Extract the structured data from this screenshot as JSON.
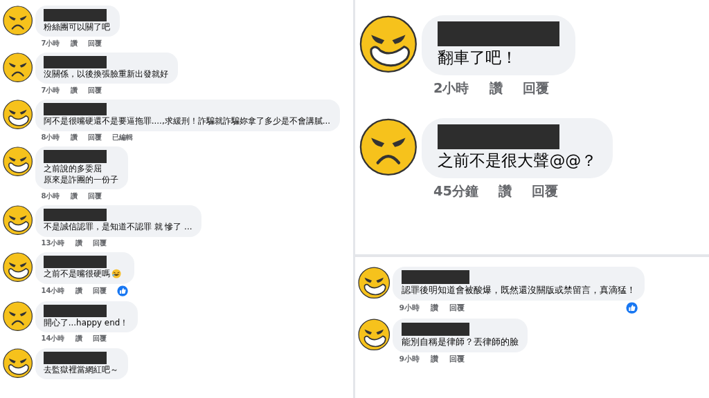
{
  "panels": [
    {
      "comments": [
        {
          "kind": "angry",
          "lines": [
            "粉絲團可以關了吧"
          ],
          "time": "7小時",
          "actions": [
            "讚",
            "回覆"
          ],
          "liked": false
        },
        {
          "kind": "angry",
          "lines": [
            "沒關係，以後換張臉重新出發就好"
          ],
          "time": "7小時",
          "actions": [
            "讚",
            "回覆"
          ],
          "liked": false
        },
        {
          "kind": "grin",
          "lines": [
            "阿不是很嘴硬還不是要逼拖罪....,求緩刑！詐騙就詐騙妳拿了多少是不會講膩..."
          ],
          "time": "8小時",
          "actions": [
            "讚",
            "回覆",
            "已編輯"
          ],
          "liked": false
        },
        {
          "kind": "grin",
          "lines": [
            "之前說的多委屈",
            "原來是詐團的一份子"
          ],
          "time": "8小時",
          "actions": [
            "讚",
            "回覆"
          ],
          "liked": false
        },
        {
          "kind": "grin",
          "lines": [
            "不是誠信認罪，是知道不認罪 就 慘了 ..."
          ],
          "time": "13小時",
          "actions": [
            "讚",
            "回覆"
          ],
          "liked": false
        },
        {
          "kind": "grin",
          "lines": [
            "之前不是嘴很硬嗎"
          ],
          "emoji": true,
          "time": "14小時",
          "actions": [
            "讚",
            "回覆"
          ],
          "liked": true
        },
        {
          "kind": "angry",
          "lines": [
            "開心了...happy end！"
          ],
          "time": "14小時",
          "actions": [
            "讚",
            "回覆"
          ],
          "liked": false
        },
        {
          "kind": "grin",
          "lines": [
            "去監獄裡當網紅吧～"
          ]
        }
      ]
    },
    {
      "comments": [
        {
          "kind": "grin",
          "lines": [
            "翻車了吧！"
          ],
          "time": "2小時",
          "actions": [
            "讚",
            "回覆"
          ],
          "liked": false
        },
        {
          "kind": "angry",
          "lines": [
            "之前不是很大聲@@？"
          ],
          "time": "45分鐘",
          "actions": [
            "讚",
            "回覆"
          ],
          "liked": false
        }
      ]
    },
    {
      "comments": [
        {
          "kind": "grin",
          "lines": [
            "認罪後明知道會被酸爆，既然還沒關版或禁留言，真滴猛！"
          ],
          "time": "9小時",
          "actions": [
            "讚",
            "回覆"
          ],
          "liked": true
        },
        {
          "kind": "grin",
          "lines": [
            "能別自稱是律師？丟律師的臉"
          ],
          "time": "9小時",
          "actions": [
            "讚",
            "回覆"
          ],
          "liked": false
        }
      ]
    }
  ]
}
